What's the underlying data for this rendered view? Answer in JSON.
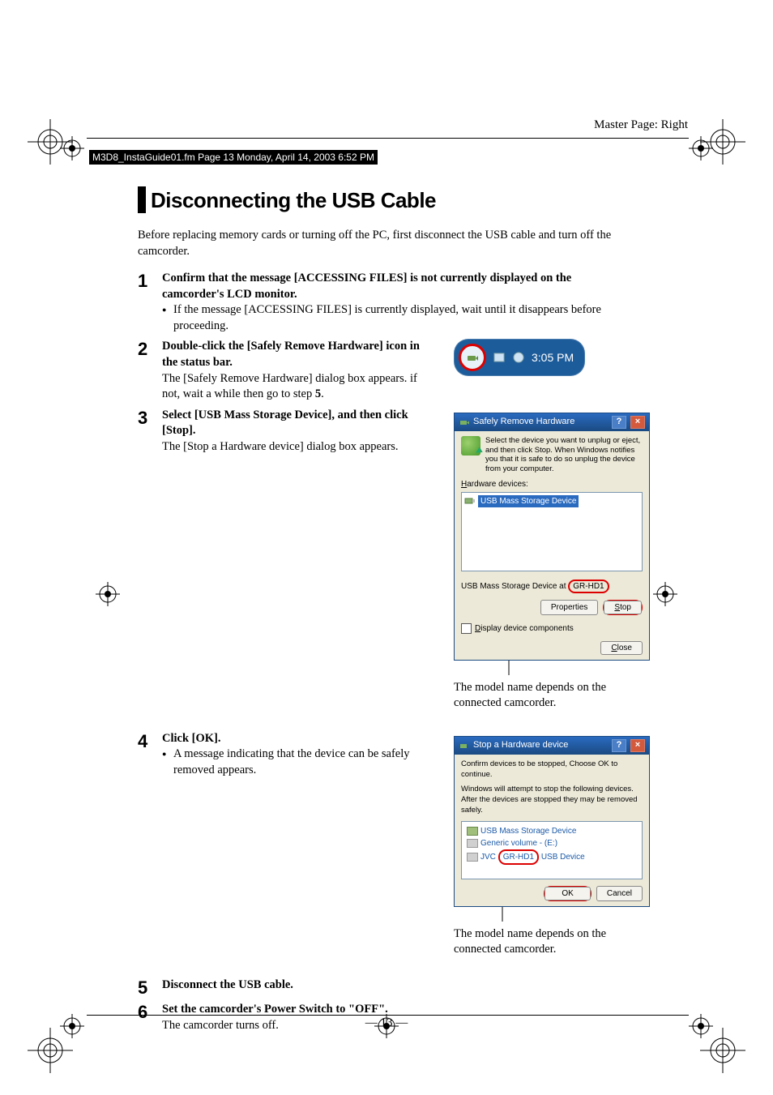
{
  "master_page": "Master Page: Right",
  "header_note": "M3D8_InstaGuide01.fm  Page 13  Monday, April 14, 2003  6:52 PM",
  "section_title": "Disconnecting the USB Cable",
  "intro": "Before replacing memory cards or turning off the PC, first disconnect the USB cable and turn off the camcorder.",
  "steps": {
    "1": {
      "heading": "Confirm that the message [ACCESSING FILES] is not currently displayed on the camcorder's LCD monitor.",
      "bullet": "If the message [ACCESSING FILES] is currently displayed, wait until it disappears before proceeding."
    },
    "2": {
      "heading": "Double-click the [Safely Remove Hardware] icon in the status bar.",
      "body_a": "The [Safely Remove Hardware] dialog box appears. if not, wait a while then go to step ",
      "body_b": "5",
      "body_c": "."
    },
    "3": {
      "heading": "Select [USB Mass Storage Device], and then click [Stop].",
      "body": "The [Stop a Hardware device] dialog box appears."
    },
    "4": {
      "heading": "Click [OK].",
      "bullet": "A message indicating that the device can be safely removed appears."
    },
    "5": {
      "heading": "Disconnect the USB cable."
    },
    "6": {
      "heading": "Set the camcorder's Power Switch to \"OFF\".",
      "body": "The camcorder turns off."
    }
  },
  "systray": {
    "time": "3:05 PM"
  },
  "dialog1": {
    "title": "Safely Remove Hardware",
    "desc": "Select the device you want to unplug or eject, and then click Stop. When Windows notifies you that it is safe to do so unplug the device from your computer.",
    "hw_label": "Hardware devices:",
    "list_item": "USB Mass Storage Device",
    "below_a": "USB Mass Storage Device at ",
    "model": "GR-HD1",
    "properties": "Properties",
    "stop": "Stop",
    "display_components": "Display device components",
    "close": "Close"
  },
  "caption1": "The model name depends on the connected camcorder.",
  "dialog2": {
    "title": "Stop a Hardware device",
    "desc1": "Confirm devices to be stopped, Choose OK to continue.",
    "desc2": "Windows will attempt to stop the following devices. After the devices are stopped they may be removed safely.",
    "item1": "USB Mass Storage Device",
    "item2": "Generic volume - (E:)",
    "item3_a": "JVC",
    "model": "GR-HD1",
    "item3_b": "USB Device",
    "ok": "OK",
    "cancel": "Cancel"
  },
  "caption2": "The model name depends on the connected camcorder.",
  "page_number": "— 13 —"
}
